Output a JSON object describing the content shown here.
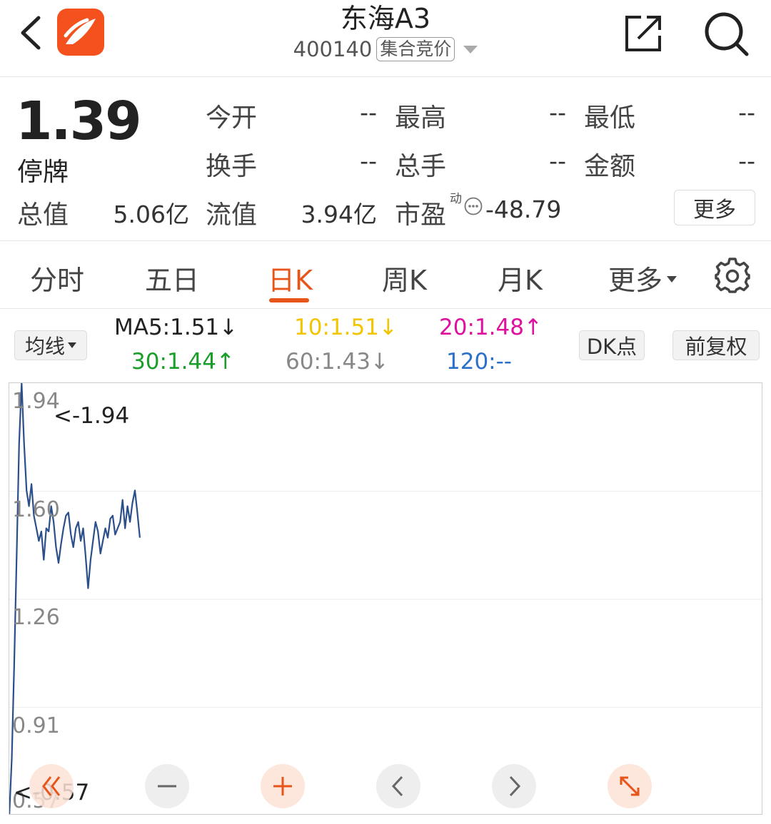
{
  "header": {
    "stock_name": "东海A3",
    "stock_code": "400140",
    "auction_badge": "集合竞价"
  },
  "quote": {
    "price": "1.39",
    "status": "停牌",
    "fields": [
      {
        "label": "今开",
        "value": "--"
      },
      {
        "label": "最高",
        "value": "--"
      },
      {
        "label": "最低",
        "value": "--"
      },
      {
        "label": "换手",
        "value": "--"
      },
      {
        "label": "总手",
        "value": "--"
      },
      {
        "label": "金额",
        "value": "--"
      }
    ],
    "total_value_label": "总值",
    "total_value": "5.06亿",
    "float_value_label": "流值",
    "float_value": "3.94亿",
    "pe_label": "市盈",
    "pe_sup": "动",
    "pe_value": "-48.79",
    "more_label": "更多"
  },
  "tabs": {
    "items": [
      "分时",
      "五日",
      "日K",
      "周K",
      "月K",
      "更多"
    ],
    "active": "日K"
  },
  "ma": {
    "selector_label": "均线",
    "items": [
      {
        "text": "MA5:1.51",
        "arrow": "↓",
        "color": "#222222"
      },
      {
        "text": "10:1.51",
        "arrow": "↓",
        "color": "#f2c500"
      },
      {
        "text": "20:1.48",
        "arrow": "↑",
        "color": "#e0109f"
      },
      {
        "text": "30:1.44",
        "arrow": "↑",
        "color": "#1a9e2a"
      },
      {
        "text": "60:1.43",
        "arrow": "↓",
        "color": "#888888"
      },
      {
        "text": "120:--",
        "arrow": "",
        "color": "#2a6fc9"
      }
    ],
    "dk_label": "DK点",
    "adjust_label": "前复权"
  },
  "colors": {
    "accent": "#e8551a",
    "line": "#2b4f8a"
  },
  "chart_data": {
    "type": "line",
    "y_ticks": [
      "1.94",
      "1.60",
      "1.26",
      "0.91",
      "0.57"
    ],
    "ylim": [
      0.57,
      1.94
    ],
    "max_label": "<-1.94",
    "min_label": "<-0.57",
    "values": [
      0.57,
      0.75,
      1.05,
      1.4,
      1.75,
      1.94,
      1.75,
      1.6,
      1.55,
      1.62,
      1.52,
      1.48,
      1.44,
      1.47,
      1.38,
      1.48,
      1.47,
      1.55,
      1.5,
      1.42,
      1.37,
      1.43,
      1.48,
      1.52,
      1.53,
      1.46,
      1.42,
      1.48,
      1.5,
      1.44,
      1.48,
      1.39,
      1.29,
      1.38,
      1.44,
      1.5,
      1.47,
      1.4,
      1.44,
      1.48,
      1.45,
      1.51,
      1.52,
      1.46,
      1.48,
      1.5,
      1.57,
      1.48,
      1.55,
      1.5,
      1.56,
      1.6,
      1.53,
      1.45
    ]
  }
}
